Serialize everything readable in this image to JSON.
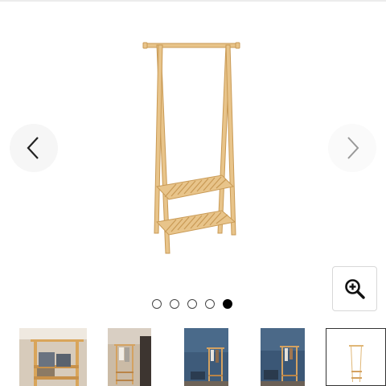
{
  "gallery": {
    "image_count": 5,
    "active_index": 4,
    "prev_icon": "chevron-left-icon",
    "next_icon": "chevron-right-icon",
    "zoom_icon": "zoom-in-icon"
  },
  "thumbnails": [
    {
      "id": "thumb-1",
      "scene": "rack-with-storage-boxes"
    },
    {
      "id": "thumb-2",
      "scene": "rack-in-hallway"
    },
    {
      "id": "thumb-3",
      "scene": "rack-against-blue-wall"
    },
    {
      "id": "thumb-4",
      "scene": "rack-against-blue-wall-2"
    },
    {
      "id": "thumb-5",
      "scene": "rack-on-white",
      "selected": true
    }
  ],
  "colors": {
    "bamboo": "#e8c48a",
    "bamboo_dark": "#c99a55",
    "wall_blue": "#3e5b7a",
    "dot_active": "#000000"
  }
}
